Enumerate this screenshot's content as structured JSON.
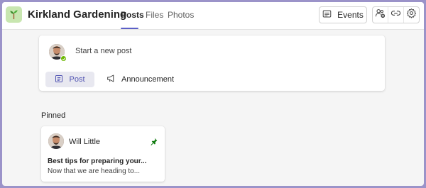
{
  "team": {
    "name": "Kirkland Gardening",
    "icon": "sprout-icon"
  },
  "tabs": [
    {
      "label": "Posts",
      "active": true
    },
    {
      "label": "Files",
      "active": false
    },
    {
      "label": "Photos",
      "active": false
    }
  ],
  "toolbar": {
    "events_label": "Events",
    "events_icon": "calendar-icon",
    "icons": [
      "add-member-icon",
      "link-icon",
      "gear-icon"
    ]
  },
  "compose": {
    "placeholder": "Start a new post",
    "post_label": "Post",
    "announcement_label": "Announcement",
    "user_status": "available"
  },
  "pinned": {
    "section_label": "Pinned",
    "author": "Will Little",
    "title": "Best tips for preparing your...",
    "preview": "Now that we are heading to..."
  },
  "colors": {
    "accent": "#5b5fc7",
    "frame_border": "#9b93c9",
    "available": "#6bb700",
    "pin": "#0e7a0d"
  }
}
